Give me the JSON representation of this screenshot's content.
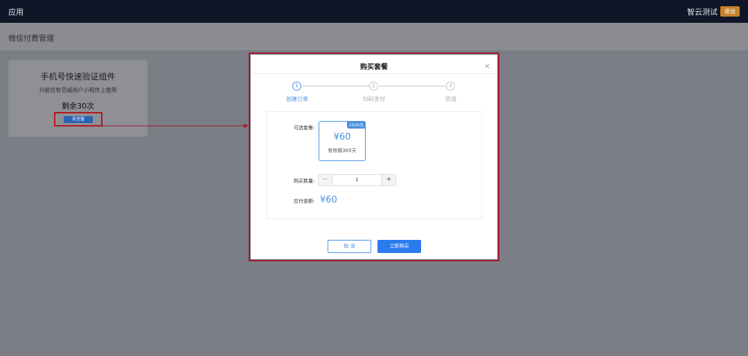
{
  "topbar": {
    "app_title": "应用",
    "user_name": "智云测试",
    "logout_label": "退出"
  },
  "page": {
    "title": "微信付费管理"
  },
  "card": {
    "title": "手机号快速验证组件",
    "description": "只能在智百威商户小程序上使用",
    "remaining": "剩余30次",
    "buy_label": "去充值"
  },
  "modal": {
    "title": "购买套餐",
    "close": "×",
    "steps": [
      {
        "num": "1",
        "label": "创建订单"
      },
      {
        "num": "2",
        "label": "扫码支付"
      },
      {
        "num": "3",
        "label": "完成"
      }
    ],
    "package_label": "可选套餐:",
    "package": {
      "badge": "1500次",
      "price": "¥60",
      "validity": "有效期365天"
    },
    "quantity_label": "购买数量:",
    "quantity": "1",
    "dec": "−",
    "inc": "+",
    "total_label": "应付金额:",
    "total": "¥60",
    "cancel_label": "取 消",
    "confirm_label": "立即购买"
  },
  "colors": {
    "accent": "#4a90e2",
    "highlight_border": "#a3182a",
    "topbar": "#0f1628"
  }
}
